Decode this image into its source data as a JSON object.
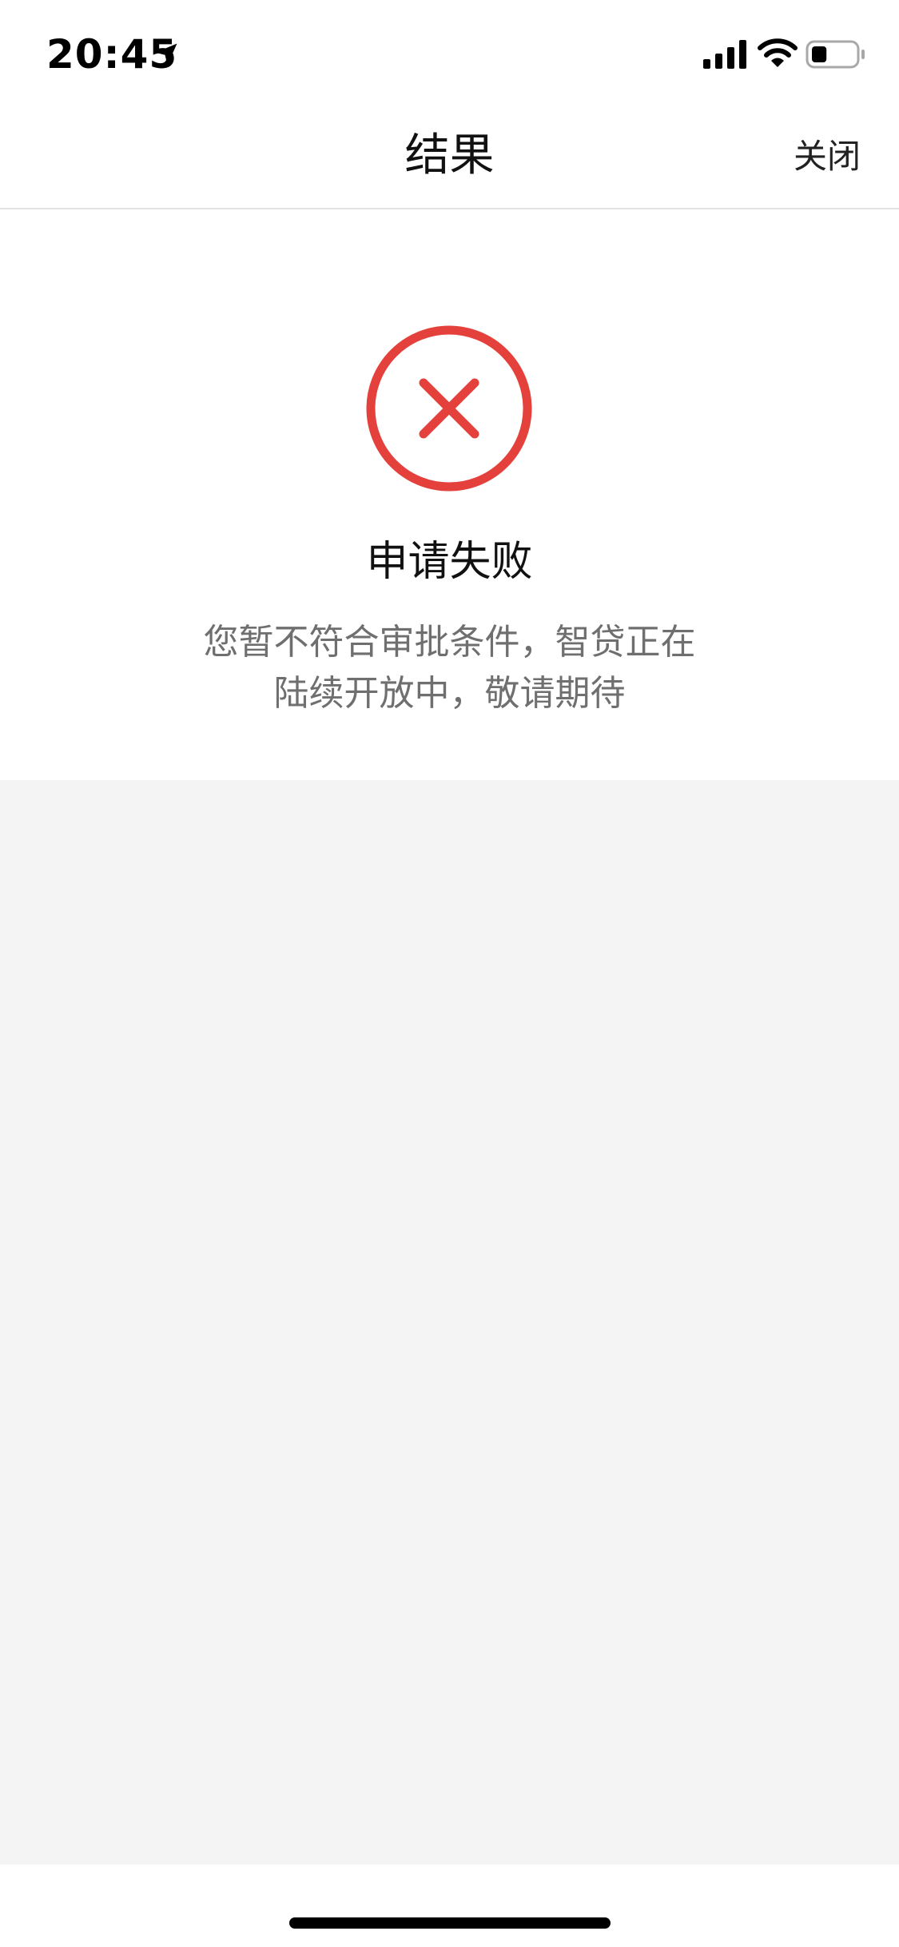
{
  "status_bar": {
    "time": "20:45",
    "icons": [
      "location-arrow-icon",
      "cellular-signal-icon",
      "wifi-icon",
      "battery-icon"
    ],
    "battery_level": 0.35
  },
  "nav": {
    "title": "结果",
    "close_label": "关闭"
  },
  "result": {
    "icon": "error-circle-x-icon",
    "title": "申请失败",
    "message_line1": "您暂不符合审批条件，智贷正在",
    "message_line2": "陆续开放中，敬请期待"
  },
  "colors": {
    "error_red": "#e5413c",
    "background": "#f4f4f4",
    "card": "#ffffff",
    "message_text": "#6f6f6f"
  }
}
